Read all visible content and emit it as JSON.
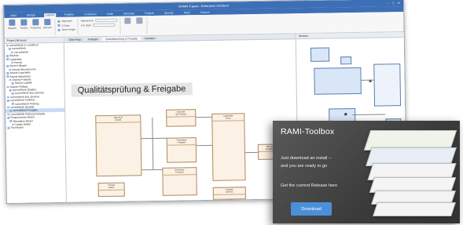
{
  "window": {
    "title": "RAMI4.0.qeax - Enterprise Architect",
    "tabs": [
      "Start",
      "Design",
      "Layout",
      "Toolbox",
      "Construct",
      "Code",
      "Simulate",
      "Publish",
      "Specify",
      "MDG",
      "Extend"
    ],
    "active_tab": "Layout"
  },
  "ribbon": {
    "buttons": [
      "Diagram",
      "Toolbox",
      "Properties",
      "Element"
    ],
    "list_items": [
      "Alignment",
      "Z-Order",
      "Same Height"
    ],
    "fields": [
      "Appearance",
      "Line Style"
    ]
  },
  "browser": {
    "title": "Project Browser",
    "items": [
      "currentWork:1 Loadsheet",
      "currentWork",
      "currentWork",
      "Struktur",
      "Lagerhalle",
      "Assets",
      "Asset Kollagen",
      "Assets Bauelemente",
      "Assets Lagerhalle",
      "Assets Maschinen",
      "Assets Produkte",
      "Assets Logistik",
      "Assets Prüfung",
      "currentWork Struktur",
      "currentWork Bus_Einsatz",
      "currentWork Bus_Betrieb",
      "currentWork Funktion",
      "currentWork Prüfung",
      "currentWork Qualität",
      "currentWork Freigabe",
      "currentWork Prüfung Freigabe",
      "Requirements Model",
      "Simulation Model",
      "Usage Model",
      "Test Model"
    ],
    "selected_index": 19
  },
  "diagram": {
    "tabs": [
      "Start Page",
      "Kollagen",
      "Qualitätsprüfung & Freigabe",
      "Funktion"
    ],
    "active_tab_index": 2,
    "title": "Qualitätsprüfung & Freigabe",
    "boxes": [
      {
        "name": "Maschine",
        "sub": "Modell"
      },
      {
        "name": "Kontrolle",
        "sub": "QS Prüfung"
      },
      {
        "name": "Lagerhalle",
        "sub": "Asset"
      },
      {
        "name": "Prüfauftrag",
        "sub": "Freigabe"
      },
      {
        "name": "Produkt",
        "sub": "Status"
      },
      {
        "name": "Dokument",
        "sub": "Protokoll"
      },
      {
        "name": "Freigabe",
        "sub": "Element"
      },
      {
        "name": "Bericht",
        "sub": "Ausgabe"
      }
    ],
    "right_title": "Struktur"
  },
  "promo": {
    "title": "RAMI-Toolbox",
    "line1": "Just download an install --",
    "line2": "and you are ready to go",
    "line3": "Get the current Release here",
    "button": "Download"
  }
}
